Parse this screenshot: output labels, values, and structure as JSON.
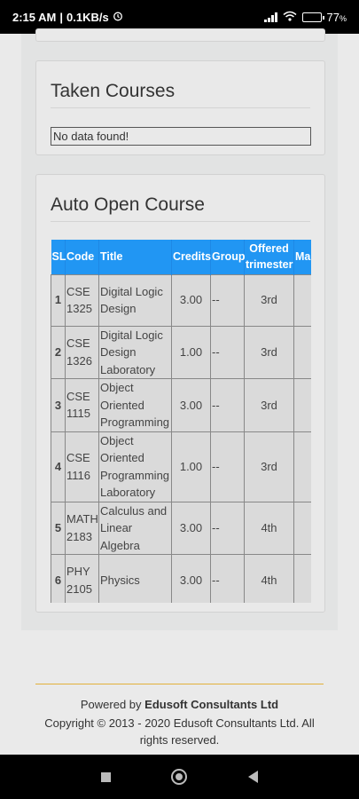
{
  "status_bar": {
    "time": "2:15 AM",
    "speed": "0.1KB/s",
    "battery_text": "77",
    "battery_level": 0.77
  },
  "taken_courses": {
    "title": "Taken Courses",
    "empty_message": "No data found!"
  },
  "auto_open": {
    "title": "Auto Open Course",
    "columns": [
      "SL",
      "Code",
      "Title",
      "Credits",
      "Group",
      "Offered trimester",
      "Ma"
    ],
    "rows": [
      {
        "sl": "1",
        "code": "CSE 1325",
        "title": "Digital Logic Design",
        "credits": "3.00",
        "group": "--",
        "trimester": "3rd"
      },
      {
        "sl": "2",
        "code": "CSE 1326",
        "title": "Digital Logic Design Laboratory",
        "credits": "1.00",
        "group": "--",
        "trimester": "3rd"
      },
      {
        "sl": "3",
        "code": "CSE 1115",
        "title": "Object Oriented Programming",
        "credits": "3.00",
        "group": "--",
        "trimester": "3rd"
      },
      {
        "sl": "4",
        "code": "CSE 1116",
        "title": "Object Oriented Programming Laboratory",
        "credits": "1.00",
        "group": "--",
        "trimester": "3rd"
      },
      {
        "sl": "5",
        "code": "MATH 2183",
        "title": "Calculus and Linear Algebra",
        "credits": "3.00",
        "group": "--",
        "trimester": "4th"
      },
      {
        "sl": "6",
        "code": "PHY 2105",
        "title": "Physics",
        "credits": "3.00",
        "group": "--",
        "trimester": "4th"
      }
    ]
  },
  "footer": {
    "powered_prefix": "Powered by ",
    "powered_company": "Edusoft Consultants Ltd",
    "copyright": "Copyright © 2013 - 2020 Edusoft Consultants Ltd. All rights reserved."
  },
  "icons": {
    "alarm": "alarm-icon",
    "signal": "signal-icon",
    "wifi": "wifi-icon",
    "battery": "battery-icon",
    "nav_recent": "square-icon",
    "nav_home": "circle-icon",
    "nav_back": "back-triangle-icon"
  },
  "colors": {
    "table_header": "#2196f3",
    "footer_rule": "#e2b13c"
  }
}
